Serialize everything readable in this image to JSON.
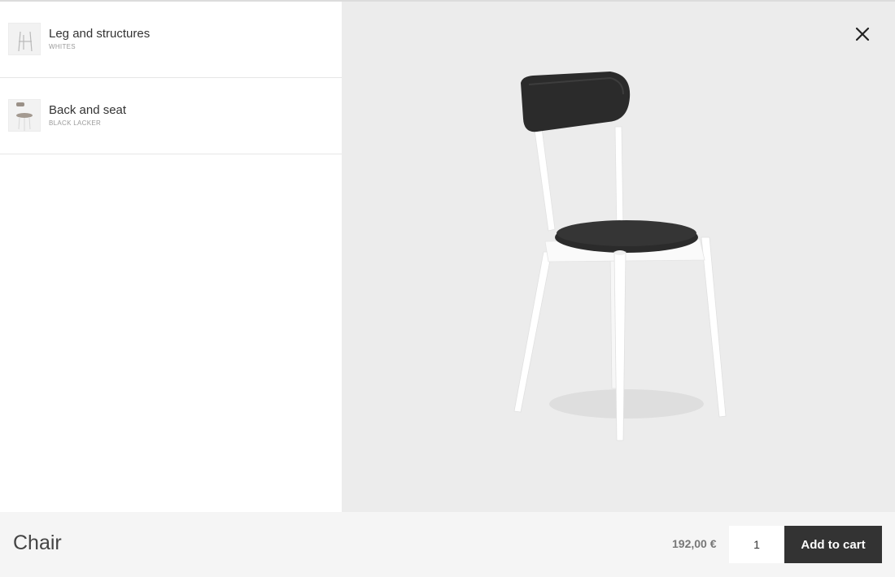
{
  "options": [
    {
      "title": "Leg and structures",
      "subtitle": "WHITES",
      "thumb_icon": "chair-legs-thumbnail"
    },
    {
      "title": "Back and seat",
      "subtitle": "BLACK LACKER",
      "thumb_icon": "chair-back-seat-thumbnail"
    }
  ],
  "preview": {
    "close_icon": "close-icon",
    "image": "chair-product-image"
  },
  "footer": {
    "product_name": "Chair",
    "price": "192,00 €",
    "quantity": "1",
    "add_to_cart_label": "Add to cart"
  },
  "colors": {
    "preview_bg": "#ececec",
    "footer_bg": "#f5f5f5",
    "button_bg": "#333333",
    "chair_legs": "#ffffff",
    "chair_seat": "#2b2b2b"
  }
}
